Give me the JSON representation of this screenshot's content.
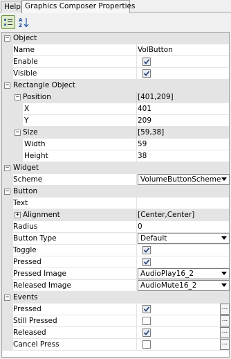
{
  "tabs": [
    {
      "label": "Help"
    },
    {
      "label": "Graphics Composer Properties"
    }
  ],
  "categories": {
    "object": "Object",
    "rectangle_object": "Rectangle Object",
    "widget": "Widget",
    "button": "Button",
    "events": "Events"
  },
  "rows": {
    "name": {
      "label": "Name",
      "value": "VolButton"
    },
    "enable": {
      "label": "Enable",
      "checked": true
    },
    "visible": {
      "label": "Visible",
      "checked": true
    },
    "position": {
      "label": "Position",
      "value": "[401,209]"
    },
    "x": {
      "label": "X",
      "value": "401"
    },
    "y": {
      "label": "Y",
      "value": "209"
    },
    "size": {
      "label": "Size",
      "value": "[59,38]"
    },
    "width": {
      "label": "Width",
      "value": "59"
    },
    "height": {
      "label": "Height",
      "value": "38"
    },
    "scheme": {
      "label": "Scheme",
      "value": "VolumeButtonScheme"
    },
    "text": {
      "label": "Text",
      "value": ""
    },
    "alignment": {
      "label": "Alignment",
      "value": "[Center,Center]"
    },
    "radius": {
      "label": "Radius",
      "value": "0"
    },
    "button_type": {
      "label": "Button Type",
      "value": "Default"
    },
    "toggle": {
      "label": "Toggle",
      "checked": true
    },
    "pressed": {
      "label": "Pressed",
      "checked": true
    },
    "pressed_image": {
      "label": "Pressed Image",
      "value": "AudioPlay16_2"
    },
    "released_image": {
      "label": "Released Image",
      "value": "AudioMute16_2"
    },
    "ev_pressed": {
      "label": "Pressed",
      "checked": true
    },
    "ev_still_pressed": {
      "label": "Still Pressed",
      "checked": false
    },
    "ev_released": {
      "label": "Released",
      "checked": true
    },
    "ev_cancel_press": {
      "label": "Cancel Press",
      "checked": false
    }
  },
  "ellipsis_label": "...",
  "expander": {
    "collapse": "−",
    "expand": "+"
  }
}
